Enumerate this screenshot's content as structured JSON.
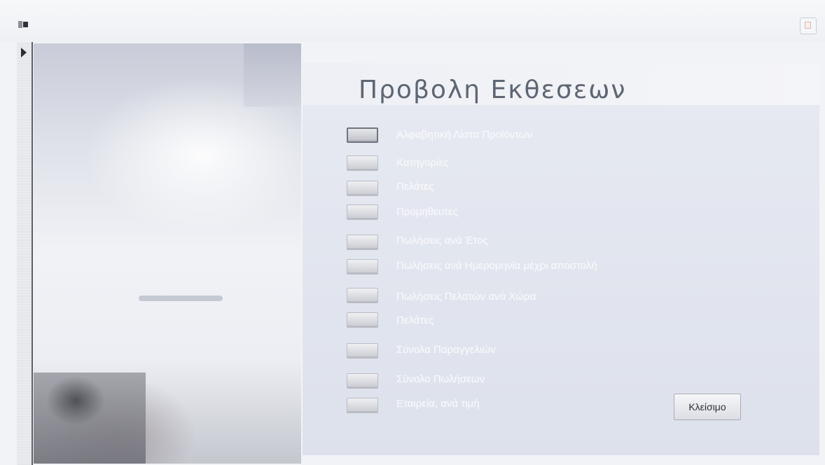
{
  "form": {
    "title": "Προβολη Εκθεσεων",
    "close_label": "Κλείσιμο"
  },
  "reports": [
    {
      "label": "Αλφαβητική Λίστα Προϊόντων"
    },
    {
      "label": "Κατηγορίες"
    },
    {
      "label": "Πελάτες"
    },
    {
      "label": "Προμηθευτές"
    },
    {
      "label": "Πωλήσεις ανά Έτος"
    },
    {
      "label": "Πωλήσεις ανά Ημερομηνία μέχρι αποστολή"
    },
    {
      "label": "Πωλήσεις Πελατών ανά Χώρα"
    },
    {
      "label": "Πελάτες"
    },
    {
      "label": "Σύνολα Παραγγελιών"
    },
    {
      "label": "Σύνολο Πωλήσεων"
    },
    {
      "label": "Εταιρεία, ανά τιμή"
    }
  ],
  "colors": {
    "title_text": "#5e6673",
    "panel": "#e6e9f1",
    "report_label": "#f7f8fb"
  }
}
